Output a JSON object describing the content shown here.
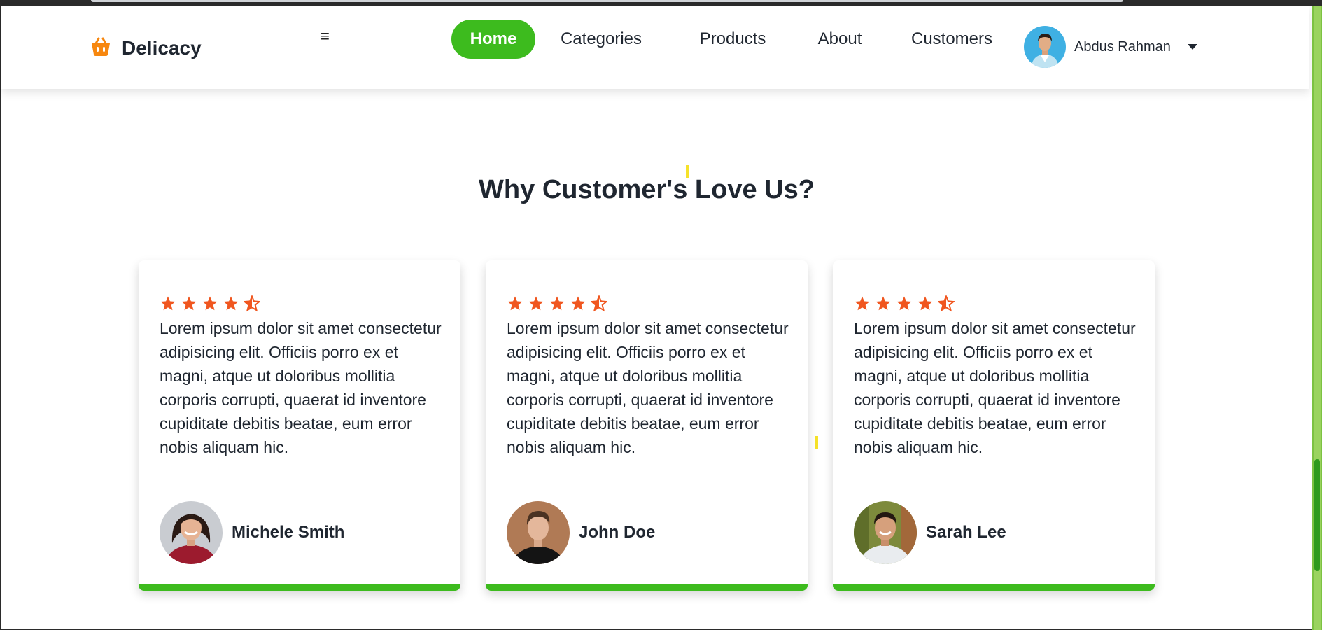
{
  "brand": {
    "name": "Delicacy",
    "accent": "#f7870f"
  },
  "nav": {
    "items": [
      {
        "label": "Home",
        "active": true
      },
      {
        "label": "Categories",
        "active": false
      },
      {
        "label": "Products",
        "active": false
      },
      {
        "label": "About",
        "active": false
      },
      {
        "label": "Customers",
        "active": false
      }
    ],
    "active_color": "#3dbb1e"
  },
  "user": {
    "name": "Abdus Rahman"
  },
  "section": {
    "title": "Why Customer's Love Us?"
  },
  "testimonials": [
    {
      "rating": 4.5,
      "text": "Lorem ipsum dolor sit amet consectetur adipisicing elit. Officiis porro ex et magni, atque ut doloribus mollitia corporis corrupti, quaerat id inventore cupiditate debitis beatae, eum error nobis aliquam hic.",
      "name": "Michele Smith"
    },
    {
      "rating": 4.5,
      "text": "Lorem ipsum dolor sit amet consectetur adipisicing elit. Officiis porro ex et magni, atque ut doloribus mollitia corporis corrupti, quaerat id inventore cupiditate debitis beatae, eum error nobis aliquam hic.",
      "name": "John Doe"
    },
    {
      "rating": 4.5,
      "text": "Lorem ipsum dolor sit amet consectetur adipisicing elit. Officiis porro ex et magni, atque ut doloribus mollitia corporis corrupti, quaerat id inventore cupiditate debitis beatae, eum error nobis aliquam hic.",
      "name": "Sarah Lee"
    }
  ],
  "colors": {
    "star": "#f0561f",
    "card_border": "#3dbb1e",
    "scrollbar": "#7cc242"
  },
  "icons": {
    "brand": "basket-icon",
    "menu": "hamburger-icon",
    "dropdown": "caret-down-icon",
    "rating": "star-icon"
  }
}
